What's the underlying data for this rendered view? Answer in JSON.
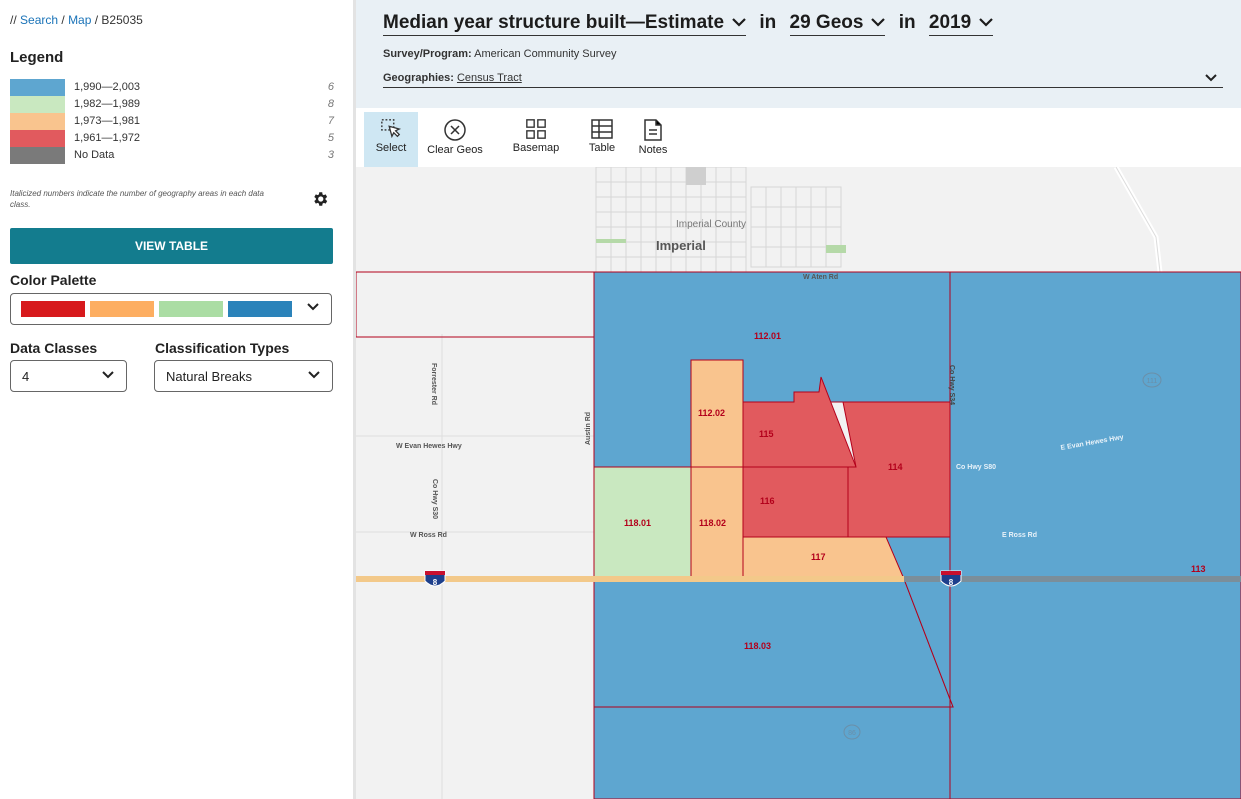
{
  "breadcrumb": {
    "prefix": "// ",
    "search": "Search",
    "sep1": " / ",
    "map": "Map",
    "sep2": " / ",
    "table_id": "B25035"
  },
  "legend": {
    "title": "Legend",
    "items": [
      {
        "range": "1,990—2,003",
        "count": "6",
        "color": "#5ea6d0"
      },
      {
        "range": "1,982—1,989",
        "count": "8",
        "color": "#c9e8c0"
      },
      {
        "range": "1,973—1,981",
        "count": "7",
        "color": "#f9c48e"
      },
      {
        "range": "1,961—1,972",
        "count": "5",
        "color": "#e15a5e"
      },
      {
        "range": "No Data",
        "count": "3",
        "color": "#7a7a7a"
      }
    ],
    "note": "Italicized numbers indicate the number of geography areas in each data class."
  },
  "view_table_label": "VIEW TABLE",
  "color_palette": {
    "label": "Color Palette",
    "colors": [
      "#d7191c",
      "#fdae61",
      "#abdda4",
      "#2b83ba"
    ]
  },
  "data_classes": {
    "label": "Data Classes",
    "value": "4"
  },
  "classification": {
    "label": "Classification Types",
    "value": "Natural Breaks"
  },
  "header": {
    "variable": "Median year structure built—Estimate",
    "in1": "in",
    "geos": "29 Geos",
    "in2": "in",
    "year": "2019",
    "survey_label": "Survey/Program:",
    "survey_value": "American Community Survey",
    "geographies_label": "Geographies:",
    "geographies_value": "Census Tract"
  },
  "toolbar": {
    "select": "Select",
    "clear_geos": "Clear Geos",
    "basemap": "Basemap",
    "table": "Table",
    "notes": "Notes"
  },
  "map": {
    "place_county": "Imperial County",
    "place_city": "Imperial",
    "roads": {
      "w_aten": "W Aten Rd",
      "forrester": "Forrester Rd",
      "austin": "Austin Rd",
      "w_evan_hewes": "W Evan Hewes Hwy",
      "co_hwy_s30": "Co Hwy S30",
      "w_ross": "W Ross Rd",
      "co_hwy_s34": "Co Hwy S34",
      "e_evan_hewes": "E Evan Hewes Hwy",
      "co_hwy_s80": "Co Hwy S80",
      "e_ross": "E Ross Rd"
    },
    "shields": {
      "i8": "8",
      "sr111": "111",
      "sr86": "86"
    },
    "tracts": {
      "t112_01": "112.01",
      "t112_02": "112.02",
      "t115": "115",
      "t114": "114",
      "t116": "116",
      "t118_01": "118.01",
      "t118_02": "118.02",
      "t117": "117",
      "t113": "113",
      "t118_03": "118.03"
    },
    "colors": {
      "blue": "#5ea6d0",
      "green": "#c9e8c0",
      "orange": "#f9c48e",
      "red": "#e15a5e",
      "label": "#b3001b",
      "border": "#b3001b"
    }
  }
}
